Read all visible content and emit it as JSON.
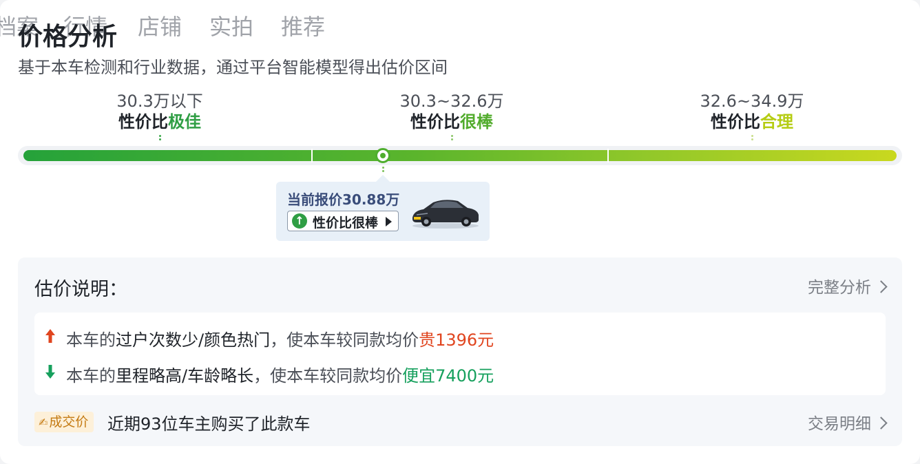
{
  "tabs": [
    {
      "label": "档案"
    },
    {
      "label": "行情"
    },
    {
      "label": "店铺"
    },
    {
      "label": "实拍"
    },
    {
      "label": "推荐"
    }
  ],
  "header": {
    "title": "价格分析",
    "subtitle": "基于本车检测和行业数据，通过平台智能模型得出估价区间"
  },
  "ranges": [
    {
      "value": "30.3万以下",
      "prefix": "性价比",
      "highlight": "极佳",
      "color": "#2f9e44"
    },
    {
      "value": "30.3~32.6万",
      "prefix": "性价比",
      "highlight": "很棒",
      "color": "#52ac2d"
    },
    {
      "value": "32.6~34.9万",
      "prefix": "性价比",
      "highlight": "合理",
      "color": "#b5cc12"
    }
  ],
  "current": {
    "text": "当前报价30.88万",
    "tag": "性价比很棒",
    "position_fraction": 0.41
  },
  "explanation": {
    "title": "估价说明：",
    "link": "完整分析",
    "reasons": [
      {
        "lead": "本车的",
        "strong": "过户次数少/颜色热门",
        "middle": "，使本车较同款均价",
        "result": "贵1396元",
        "direction": "up"
      },
      {
        "lead": "本车的",
        "strong": "里程略高/车龄略长",
        "middle": "，使本车较同款均价",
        "result": "便宜7400元",
        "direction": "down"
      }
    ],
    "deal_badge": "成交价",
    "deal_text": "近期93位车主购买了此款车",
    "deal_link": "交易明细"
  },
  "colors": {
    "up": "#e0451f",
    "down": "#16a05d",
    "bar_start": "#25a23a",
    "bar_end": "#c9d81f"
  }
}
